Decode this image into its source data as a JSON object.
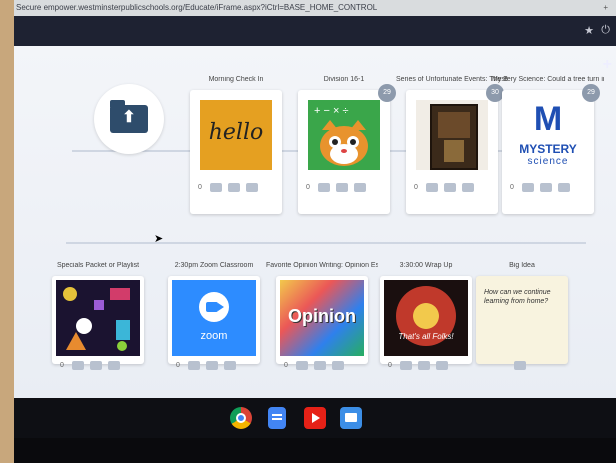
{
  "browser": {
    "url": "Secure  empower.westminsterpublicschools.org/Educate/iFrame.aspx?iCtrl=BASE_HOME_CONTROL",
    "tab_hint": "+"
  },
  "toolbar": {
    "star_icon": "star-icon",
    "power_icon": "power-icon"
  },
  "app": {
    "plus_label": "+",
    "row1": [
      {
        "title": "Morning Check In",
        "badge": "",
        "count": "0",
        "thumb": "hello"
      },
      {
        "title": "Division 16-1",
        "badge": "29",
        "count": "0",
        "thumb": "math-cat"
      },
      {
        "title": "Series of Unfortunate Events: The Bad",
        "badge": "30",
        "count": "0",
        "thumb": "book"
      },
      {
        "title": "Mystery Science: Could a tree turn into...",
        "badge": "29",
        "count": "0",
        "thumb": "mystery"
      }
    ],
    "row2": [
      {
        "title": "Specials Packet or Playlist",
        "count": "0",
        "thumb": "specials"
      },
      {
        "title": "2:30pm Zoom Classroom",
        "count": "0",
        "thumb": "zoom"
      },
      {
        "title": "Favorite Opinion Writing: Opinion Essay",
        "count": "0",
        "thumb": "opinion"
      },
      {
        "title": "3:30:00 Wrap Up",
        "count": "0",
        "thumb": "thats-all"
      },
      {
        "title": "Big Idea",
        "count": "",
        "thumb": "big-idea"
      }
    ]
  },
  "thumbs": {
    "hello_text": "hello",
    "mystery_letter": "M",
    "mystery_word1": "MYSTERY",
    "mystery_word2": "science",
    "zoom_word": "zoom",
    "opinion_word": "Opinion",
    "thats_all_text": "That's all Folks!",
    "big_idea_text": "How can we continue learning from home?"
  },
  "colors": {
    "hello_bg": "#e5a021",
    "mystery_blue": "#1f4fb3",
    "zoom_blue": "#2d8cff",
    "math_green": "#3aa64a"
  },
  "taskbar": {
    "apps": [
      "chrome-icon",
      "docs-icon",
      "youtube-icon",
      "files-icon"
    ]
  }
}
